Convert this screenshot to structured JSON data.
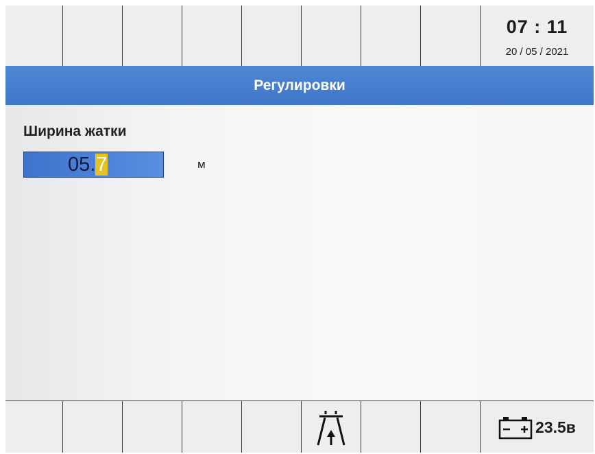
{
  "header": {
    "time": "07 : 11",
    "date": "20 / 05 / 2021"
  },
  "screen_title": "Регулировки",
  "parameter": {
    "label": "Ширина жатки",
    "value_prefix": "05.",
    "value_cursor_digit": "7",
    "unit": "м"
  },
  "footer": {
    "road_icon": "road-transport-icon",
    "battery_icon": "battery-icon",
    "battery_voltage": "23.5в"
  },
  "colors": {
    "title_bar": "#3f76c8",
    "field_bg": "#4a80d6",
    "cursor": "#e8c21e"
  }
}
